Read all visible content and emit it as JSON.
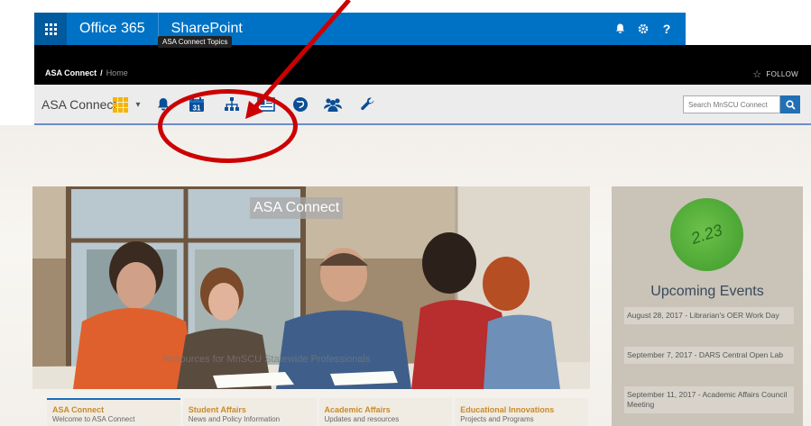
{
  "suitebar": {
    "brand": "Office 365",
    "app": "SharePoint",
    "icons": [
      "bell-icon",
      "gear-icon",
      "help-icon"
    ],
    "help_label": "?"
  },
  "header": {
    "breadcrumb_site": "ASA Connect",
    "breadcrumb_sep": "/",
    "breadcrumb_page": "Home",
    "follow_label": "FOLLOW"
  },
  "toolbar": {
    "site_name": "ASA Connect",
    "calendar_number": "31",
    "tooltip": "ASA Connect Topics",
    "search_placeholder": "Search MnSCU Connect"
  },
  "hero": {
    "title": "ASA Connect",
    "subtitle": "Resources for MnSCU Statewide Professionals"
  },
  "tabs": [
    {
      "title": "ASA Connect",
      "desc": "Welcome to ASA Connect"
    },
    {
      "title": "Student Affairs",
      "desc": "News and Policy Information"
    },
    {
      "title": "Academic Affairs",
      "desc": "Updates and resources"
    },
    {
      "title": "Educational Innovations",
      "desc": "Projects and Programs"
    }
  ],
  "events": {
    "logo_text": "2.23",
    "title": "Upcoming Events",
    "items": [
      "August 28, 2017 - Librarian's OER Work Day",
      "September 7, 2017 - DARS Central Open Lab",
      "September 11, 2017 - Academic Affairs Council Meeting"
    ]
  },
  "colors": {
    "suite_blue": "#0072c6",
    "annotation_red": "#cc0000",
    "accent_orange": "#c98a2a"
  }
}
